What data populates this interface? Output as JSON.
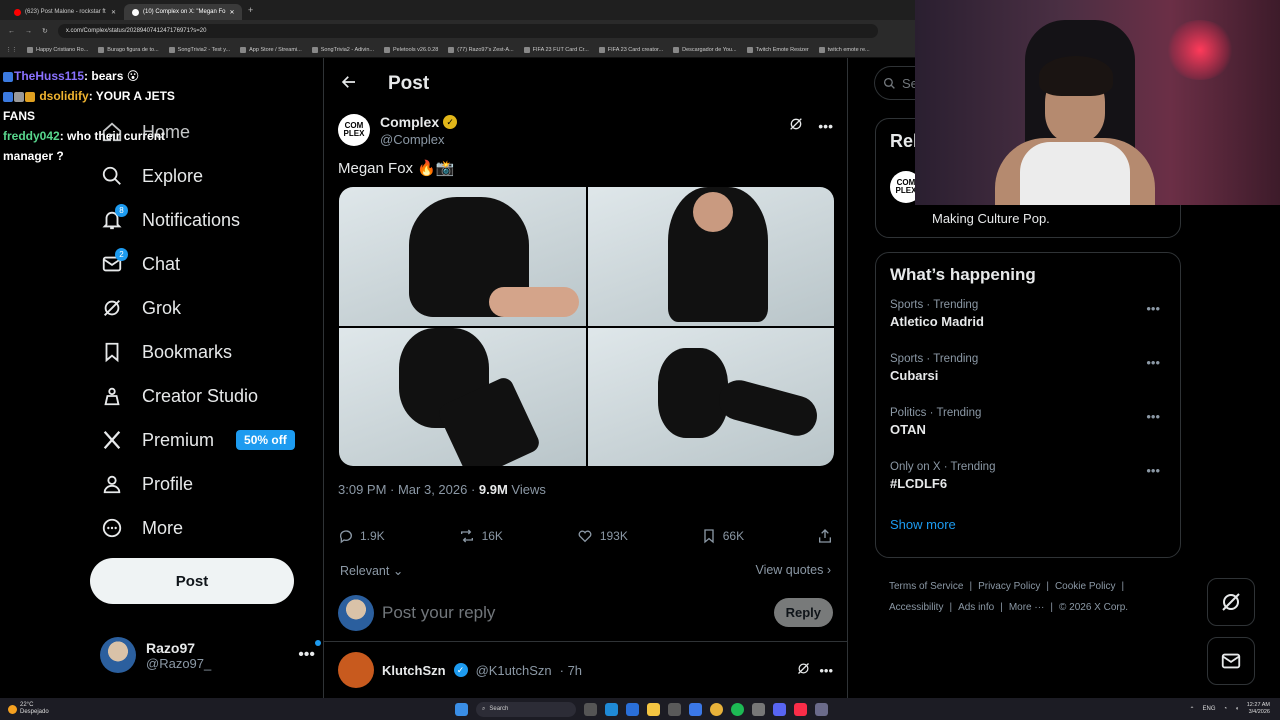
{
  "browser": {
    "tabs": [
      {
        "title": "(623) Post Malone - rockstar ft",
        "favicon_color": "#ff0000",
        "active": false
      },
      {
        "title": "(10) Complex on X: \"Megan Fo",
        "favicon_color": "#ffffff",
        "active": true
      }
    ],
    "url": "x.com/Complex/status/2028940741247176971?s=20",
    "bookmarks": [
      "Happy Cristiano Ro...",
      "Burago figura de to...",
      "SongTrivia2 - Test y...",
      "App Store / Streami...",
      "SongTrivia2 - Adivin...",
      "Peletools v26.0.28",
      "(77) Razo97's Zest-A...",
      "FIFA 23 FUT Card Cr...",
      "FIFA 23 Card creator...",
      "Descargador de You...",
      "Twitch Emote Resizer",
      "twitch emote re..."
    ]
  },
  "chat": [
    {
      "user": "TheHuss115",
      "msg": ": bears 😮"
    },
    {
      "user": "dsolidify",
      "msg": ": YOUR A JETS FANS"
    },
    {
      "user": "freddy042",
      "msg": ": who their current manager ?"
    }
  ],
  "nav": {
    "items": [
      {
        "label": "Home",
        "icon": "home-icon"
      },
      {
        "label": "Explore",
        "icon": "search-icon"
      },
      {
        "label": "Notifications",
        "icon": "bell-icon",
        "badge": "8"
      },
      {
        "label": "Chat",
        "icon": "mail-icon",
        "badge": "2"
      },
      {
        "label": "Grok",
        "icon": "grok-icon"
      },
      {
        "label": "Bookmarks",
        "icon": "bookmark-icon"
      },
      {
        "label": "Creator Studio",
        "icon": "creator-studio-icon"
      },
      {
        "label": "Premium",
        "icon": "x-logo-icon",
        "pill": "50% off"
      },
      {
        "label": "Profile",
        "icon": "person-icon"
      },
      {
        "label": "More",
        "icon": "more-circle-icon"
      }
    ],
    "post_button": "Post",
    "account": {
      "name": "Razo97",
      "handle": "@Razo97_"
    }
  },
  "main": {
    "header_title": "Post",
    "tweet": {
      "author_name": "Complex",
      "author_handle": "@Complex",
      "logo_text": "COM PLEX",
      "text": "Megan Fox 🔥📸",
      "time": "3:09 PM · Mar 3, 2026 · ",
      "views_count": "9.9M",
      "views_label": " Views",
      "stats": {
        "replies": "1.9K",
        "reposts": "16K",
        "likes": "193K",
        "bookmarks": "66K"
      }
    },
    "sort_label": "Relevant",
    "view_quotes": "View quotes",
    "reply_placeholder": "Post your reply",
    "reply_button": "Reply",
    "next_tweet": {
      "name": "KlutchSzn",
      "handle": "@K1utchSzn",
      "time": "· 7h"
    }
  },
  "right": {
    "search_placeholder": "Se",
    "relevant_title": "Rel",
    "relevant_logo": "COM PLEX",
    "relevant_bio": "Making Culture Pop.",
    "happening_title": "What’s happening",
    "trends": [
      {
        "category": "Sports · Trending",
        "name": "Atletico Madrid"
      },
      {
        "category": "Sports · Trending",
        "name": "Cubarsi"
      },
      {
        "category": "Politics · Trending",
        "name": "OTAN"
      },
      {
        "category": "Only on X · Trending",
        "name": "#LCDLF6"
      }
    ],
    "show_more": "Show more",
    "footer": [
      "Terms of Service",
      "Privacy Policy",
      "Cookie Policy",
      "Accessibility",
      "Ads info",
      "More ···",
      "© 2026 X Corp."
    ]
  },
  "taskbar": {
    "temp": "22°C",
    "weather": "Despejado",
    "search": "Search",
    "lang": "ENG",
    "time": "12:27 AM",
    "date": "3/4/2026"
  }
}
